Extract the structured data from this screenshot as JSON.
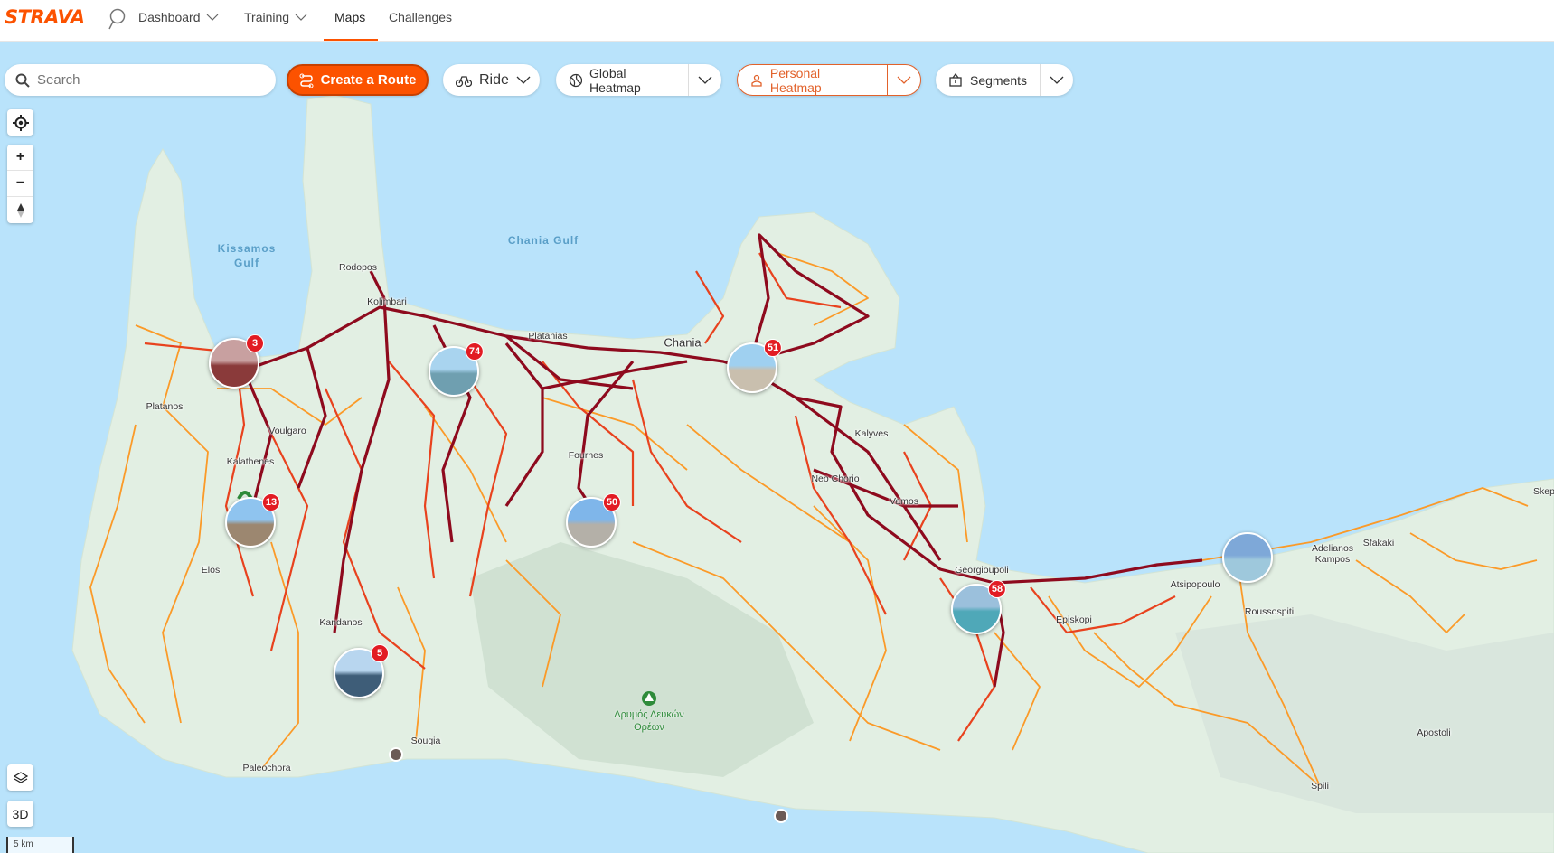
{
  "header": {
    "logo": "STRAVA",
    "nav": [
      {
        "label": "Dashboard",
        "dropdown": true
      },
      {
        "label": "Training",
        "dropdown": true
      },
      {
        "label": "Maps",
        "active": true
      },
      {
        "label": "Challenges"
      }
    ]
  },
  "toolbar": {
    "search_placeholder": "Search",
    "search_value": "",
    "create_route": "Create a Route",
    "sport": "Ride",
    "global_heatmap": "Global Heatmap",
    "personal_heatmap": "Personal Heatmap",
    "segments": "Segments"
  },
  "controls": {
    "zoom_in": "+",
    "zoom_out": "−",
    "three_d": "3D",
    "scale": "5 km"
  },
  "colors": {
    "brand": "#fc5200",
    "sea": "#b9e3fb",
    "land": "#e2efe3",
    "heat_high": "#8e0a1e",
    "heat_mid": "#e8421e",
    "heat_low": "#fb9a28",
    "badge": "#e21b23"
  },
  "water_labels": [
    {
      "line1": "Kissamos",
      "line2": "Gulf"
    },
    {
      "line1": "Chania Gulf",
      "line2": ""
    }
  ],
  "places": [
    "Rodopos",
    "Kolimbari",
    "Platanias",
    "Chania",
    "Platanos",
    "Voulgaro",
    "Kalathenes",
    "Fournes",
    "Kalyves",
    "Neo Chorio",
    "Vamos",
    "Georgioupoli",
    "Episkopi",
    "Atsipopoulo",
    "Adelianos",
    "Kampos",
    "Sfakaki",
    "Skep",
    "Roussospiti",
    "Elos",
    "Kandanos",
    "Sougia",
    "Paleochora",
    "Apostoli",
    "Spili"
  ],
  "park": {
    "line1": "Δρυμός Λευκών",
    "line2": "Ορέων"
  },
  "photo_clusters": [
    {
      "count": "3",
      "photo": "bicycle"
    },
    {
      "count": "74",
      "photo": "sea-harbor"
    },
    {
      "count": "51",
      "photo": "bicycle-beach"
    },
    {
      "count": "13",
      "photo": "stone-church"
    },
    {
      "count": "50",
      "photo": "bicycle-sign"
    },
    {
      "count": "5",
      "photo": "coast-view"
    },
    {
      "count": "58",
      "photo": "lake-view"
    },
    {
      "count": null,
      "photo": "lighthouse"
    }
  ]
}
